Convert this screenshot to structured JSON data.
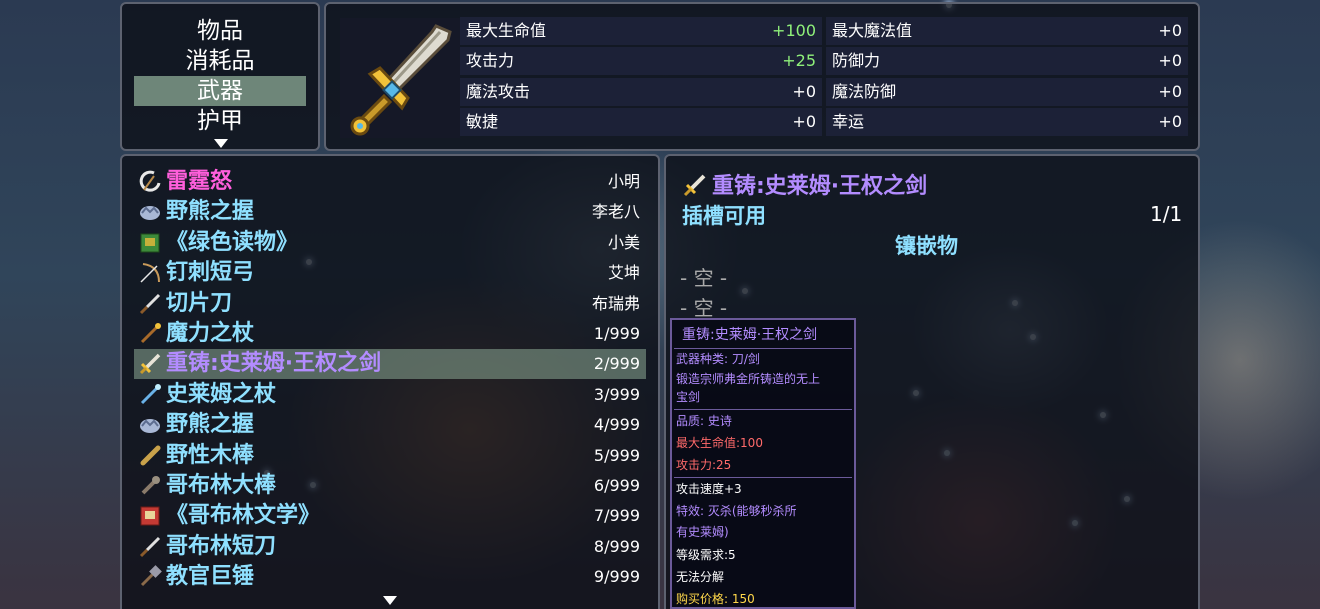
{
  "categories": {
    "items": [
      "物品",
      "消耗品",
      "武器",
      "护甲"
    ],
    "selected_index": 2
  },
  "weapon_stats": {
    "icon": "sword-icon",
    "rows": [
      {
        "left_name": "最大生命值",
        "left_value": "+100",
        "right_name": "最大魔法值",
        "right_value": "+0"
      },
      {
        "left_name": "攻击力",
        "left_value": "+25",
        "right_name": "防御力",
        "right_value": "+0"
      },
      {
        "left_name": "魔法攻击",
        "left_value": "+0",
        "right_name": "魔法防御",
        "right_value": "+0"
      },
      {
        "left_name": "敏捷",
        "left_value": "+0",
        "right_name": "幸运",
        "right_value": "+0"
      }
    ]
  },
  "item_list": {
    "selected_index": 6,
    "items": [
      {
        "name": "雷霆怒",
        "count": "小明",
        "color": "#ff5fdc",
        "icon": "scythe-icon"
      },
      {
        "name": "野熊之握",
        "count": "李老八",
        "color": "#8fe0ff",
        "icon": "gauntlet-icon"
      },
      {
        "name": "《绿色读物》",
        "count": "小美",
        "color": "#8fe0ff",
        "icon": "green-book-icon"
      },
      {
        "name": "钉刺短弓",
        "count": "艾坤",
        "color": "#8fe0ff",
        "icon": "bow-icon"
      },
      {
        "name": "切片刀",
        "count": "布瑞弗",
        "color": "#8fe0ff",
        "icon": "knife-icon"
      },
      {
        "name": "魔力之杖",
        "count": "1/999",
        "color": "#8fe0ff",
        "icon": "staff-icon"
      },
      {
        "name": "重铸:史莱姆·王权之剑",
        "count": "2/999",
        "color": "#b38cff",
        "icon": "sword-icon"
      },
      {
        "name": "史莱姆之杖",
        "count": "3/999",
        "color": "#8fe0ff",
        "icon": "wand-icon"
      },
      {
        "name": "野熊之握",
        "count": "4/999",
        "color": "#8fe0ff",
        "icon": "gauntlet-icon"
      },
      {
        "name": "野性木棒",
        "count": "5/999",
        "color": "#8fe0ff",
        "icon": "club-icon"
      },
      {
        "name": "哥布林大棒",
        "count": "6/999",
        "color": "#8fe0ff",
        "icon": "spiked-club-icon"
      },
      {
        "name": "《哥布林文学》",
        "count": "7/999",
        "color": "#8fe0ff",
        "icon": "red-book-icon"
      },
      {
        "name": "哥布林短刀",
        "count": "8/999",
        "color": "#8fe0ff",
        "icon": "knife-icon"
      },
      {
        "name": "教官巨锤",
        "count": "9/999",
        "color": "#8fe0ff",
        "icon": "hammer-icon"
      }
    ]
  },
  "detail": {
    "title": "重铸:史莱姆·王权之剑",
    "title_color": "#b38cff",
    "slots_label": "插槽可用",
    "slots_count": "1/1",
    "inlay_label": "镶嵌物",
    "empty_slots": [
      "- 空 -",
      "- 空 -"
    ]
  },
  "tooltip": {
    "title": "重铸:史莱姆·王权之剑",
    "weapon_type": "武器种类: 刀/剑",
    "description": [
      "锻造宗师弗金所铸造的无上",
      "宝剑"
    ],
    "quality": "品质: 史诗",
    "hp_bonus": "最大生命值:100",
    "attack_bonus": "攻击力:25",
    "attack_speed": "攻击速度+3",
    "special": [
      "特效: 灭杀(能够秒杀所",
      "有史莱姆)"
    ],
    "level_req": "等级需求:5",
    "no_disassemble": "无法分解",
    "price": "购买价格: 150",
    "colors": {
      "purple": "#b38cff",
      "red": "#ff6a6a",
      "white": "#ffffff",
      "gold": "#ffd84a"
    }
  }
}
